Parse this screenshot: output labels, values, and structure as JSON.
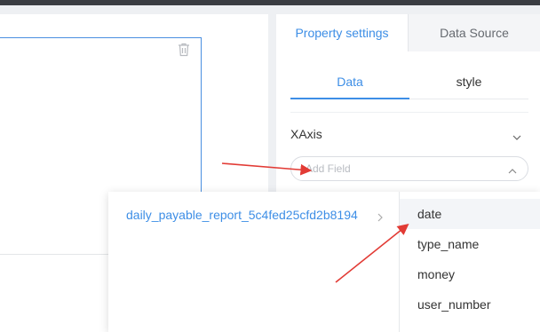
{
  "panel": {
    "tabs": [
      {
        "label": "Property settings"
      },
      {
        "label": "Data Source"
      }
    ],
    "subtabs": [
      {
        "label": "Data"
      },
      {
        "label": "style"
      }
    ],
    "xaxis": {
      "label": "XAxis"
    },
    "add_field": {
      "placeholder": "Add Field"
    }
  },
  "dropdown": {
    "source": "daily_payable_report_5c4fed25cfd2b8194",
    "fields": [
      "date",
      "type_name",
      "money",
      "user_number"
    ]
  },
  "colors": {
    "accent": "#3d8ee6",
    "annotation_arrow": "#e23b35"
  }
}
